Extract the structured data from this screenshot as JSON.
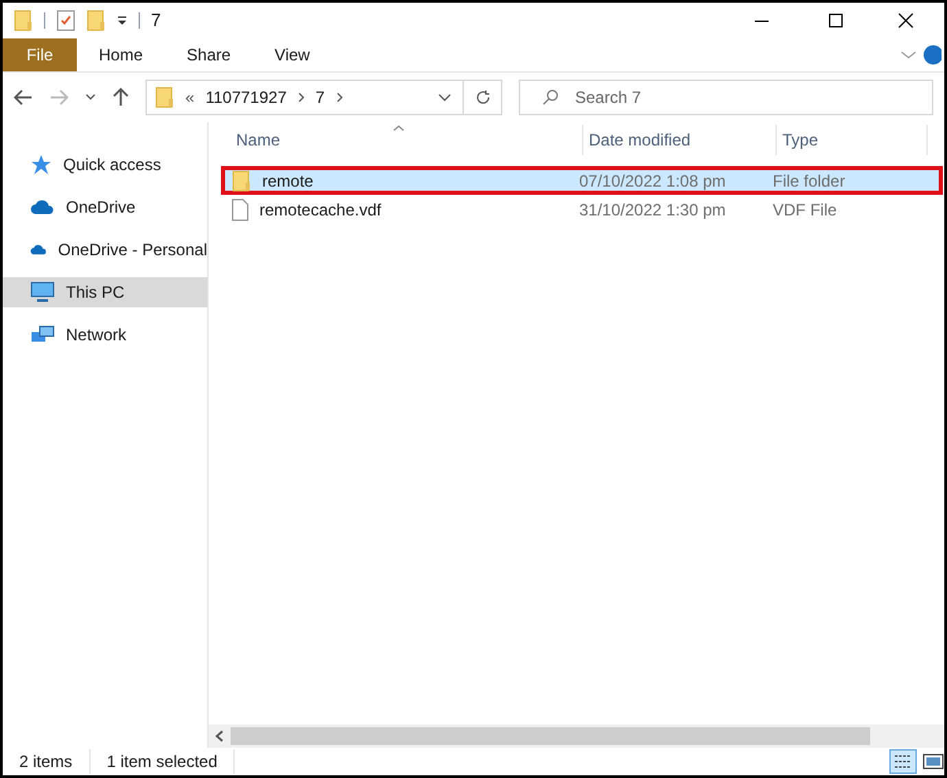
{
  "window": {
    "title": "7"
  },
  "ribbon_tabs": [
    {
      "label": "File",
      "selected": true
    },
    {
      "label": "Home",
      "selected": false
    },
    {
      "label": "Share",
      "selected": false
    },
    {
      "label": "View",
      "selected": false
    }
  ],
  "address": {
    "overflow": "«",
    "path": [
      "110771927",
      "7"
    ]
  },
  "search": {
    "placeholder": "Search 7"
  },
  "sidebar": {
    "items": [
      {
        "label": "Quick access",
        "kind": "star",
        "selected": false
      },
      {
        "label": "OneDrive",
        "kind": "cloud",
        "selected": false
      },
      {
        "label": "OneDrive - Personal",
        "kind": "cloud",
        "selected": false
      },
      {
        "label": "This PC",
        "kind": "pc",
        "selected": true
      },
      {
        "label": "Network",
        "kind": "network",
        "selected": false
      }
    ]
  },
  "table": {
    "columns": [
      "Name",
      "Date modified",
      "Type"
    ],
    "rows": [
      {
        "name": "remote",
        "date": "07/10/2022 1:08 pm",
        "type": "File folder",
        "kind": "folder",
        "selected": true,
        "outlined": true
      },
      {
        "name": "remotecache.vdf",
        "date": "31/10/2022 1:30 pm",
        "type": "VDF File",
        "kind": "file",
        "selected": false,
        "outlined": false
      }
    ]
  },
  "status_bar": {
    "count": "2 items",
    "selection": "1 item selected"
  }
}
